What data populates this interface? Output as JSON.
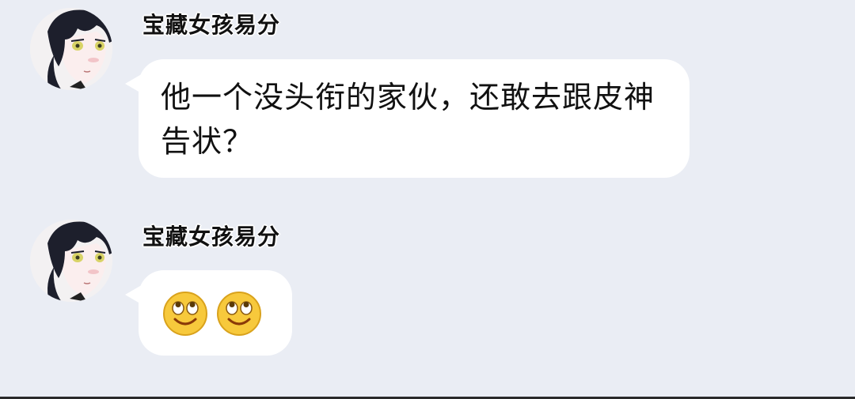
{
  "colors": {
    "background": "#eaedf4",
    "bubble": "#ffffff",
    "text": "#111111",
    "emoji_face": "#f7c93c"
  },
  "messages": [
    {
      "sender": "宝藏女孩易分",
      "avatar_icon": "anime-boy-avatar-icon",
      "text": "他一个没头衔的家伙，还敢去跟皮神告状？"
    },
    {
      "sender": "宝藏女孩易分",
      "avatar_icon": "anime-boy-avatar-icon",
      "emojis": [
        "rolling-eyes-smile-icon",
        "rolling-eyes-smile-icon"
      ]
    }
  ]
}
